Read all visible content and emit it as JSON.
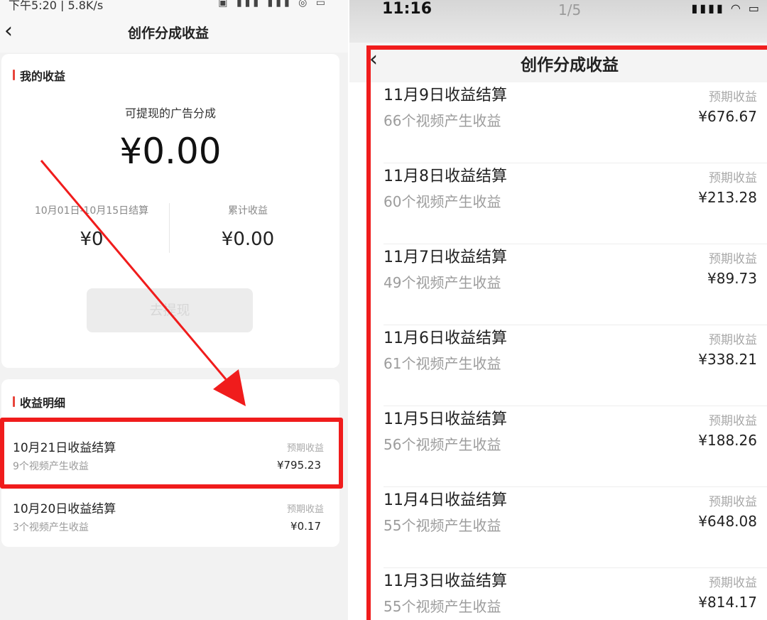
{
  "left": {
    "status": {
      "time": "下午5:20 | 5.8K/s",
      "icons": "▣ ▮▮▮ ▮▮▮ ◎ ▭"
    },
    "nav": {
      "title": "创作分成收益"
    },
    "my_earnings": {
      "section_title": "我的收益",
      "withdrawable_label": "可提现的广告分成",
      "withdrawable_amount": "¥0.00",
      "period_label": "10月01日-10月15日结算",
      "period_amount": "¥0",
      "cumulative_label": "累计收益",
      "cumulative_amount": "¥0.00",
      "withdraw_button": "去提现"
    },
    "details": {
      "section_title": "收益明细",
      "items": [
        {
          "title": "10月21日收益结算",
          "subtitle": "9个视频产生收益",
          "pred_label": "预期收益",
          "pred_value": "¥795.23"
        },
        {
          "title": "10月20日收益结算",
          "subtitle": "3个视频产生收益",
          "pred_label": "预期收益",
          "pred_value": "¥0.17"
        }
      ]
    }
  },
  "right": {
    "status": {
      "time": "11:16",
      "page": "1/5",
      "icons": "▮▮▮▮ ◠ ▭"
    },
    "nav": {
      "title": "创作分成收益"
    },
    "items": [
      {
        "title": "11月9日收益结算",
        "subtitle": "66个视频产生收益",
        "pred_label": "预期收益",
        "pred_value": "¥676.67"
      },
      {
        "title": "11月8日收益结算",
        "subtitle": "60个视频产生收益",
        "pred_label": "预期收益",
        "pred_value": "¥213.28"
      },
      {
        "title": "11月7日收益结算",
        "subtitle": "49个视频产生收益",
        "pred_label": "预期收益",
        "pred_value": "¥89.73"
      },
      {
        "title": "11月6日收益结算",
        "subtitle": "61个视频产生收益",
        "pred_label": "预期收益",
        "pred_value": "¥338.21"
      },
      {
        "title": "11月5日收益结算",
        "subtitle": "56个视频产生收益",
        "pred_label": "预期收益",
        "pred_value": "¥188.26"
      },
      {
        "title": "11月4日收益结算",
        "subtitle": "55个视频产生收益",
        "pred_label": "预期收益",
        "pred_value": "¥648.08"
      },
      {
        "title": "11月3日收益结算",
        "subtitle": "55个视频产生收益",
        "pred_label": "预期收益",
        "pred_value": "¥814.17"
      }
    ]
  },
  "colors": {
    "highlight": "#f01c1c",
    "accent": "#e8453c"
  }
}
